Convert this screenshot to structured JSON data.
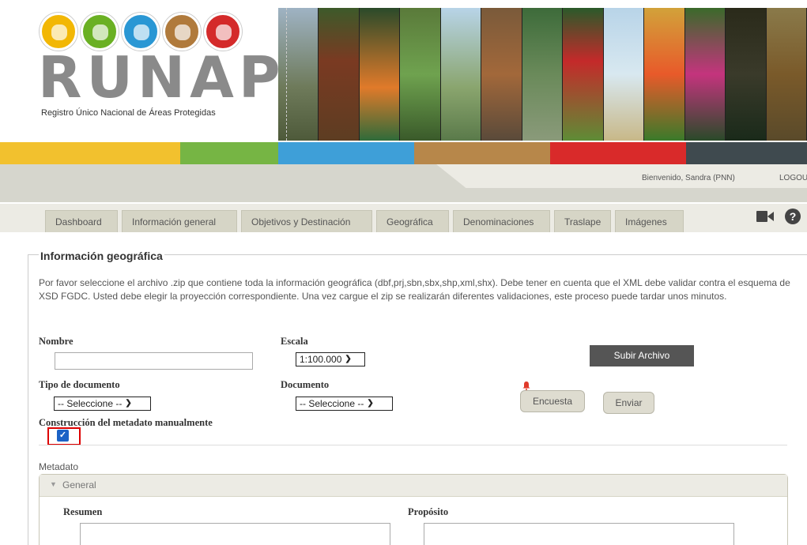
{
  "header": {
    "logo_text": "RUNAP",
    "logo_subtitle": "Registro Único Nacional de Áreas Protegidas",
    "logo_circle_colors": [
      "#f2b705",
      "#6ab023",
      "#2a97d4",
      "#b07a3c",
      "#d42a2a"
    ],
    "banner_colors": [
      "#7a8a6a",
      "#5d3d22",
      "#2f6b3a",
      "#6fa24f",
      "#8aa56e",
      "#3d6b8a",
      "#a2683a",
      "#5f8c36",
      "#d2a23a",
      "#c4347d",
      "#3a3a2a",
      "#7a5a2a"
    ]
  },
  "color_bar": [
    "#f2c12e",
    "#76b544",
    "#3e9fd8",
    "#b7874a",
    "#d92a2a",
    "#3f4a4f"
  ],
  "user_bar": {
    "welcome": "Bienvenido, Sandra (PNN)",
    "logout": "LOGOU"
  },
  "tabs": [
    "Dashboard",
    "Información general",
    "Objetivos y Destinación",
    "Geográfica",
    "Denominaciones",
    "Traslape",
    "Imágenes"
  ],
  "icons": {
    "video": "video-camera-icon",
    "help": "question-circle-icon",
    "bell": "bell-icon"
  },
  "form": {
    "legend": "Información geográfica",
    "intro": "Por favor seleccione el archivo .zip que contiene toda la información geográfica (dbf,prj,sbn,sbx,shp,xml,shx). Debe tener en cuenta que el XML debe validar contra el esquema de XSD FGDC. Usted debe elegir la proyección correspondiente. Una vez cargue el zip se realizarán diferentes validaciones, este proceso puede tardar unos minutos.",
    "nombre_label": "Nombre",
    "nombre_value": "",
    "escala_label": "Escala",
    "escala_value": "1:100.000",
    "subir_label": "Subir Archivo",
    "tipo_label": "Tipo de documento",
    "tipo_value": "-- Seleccione --",
    "documento_label": "Documento",
    "documento_value": "-- Seleccione --",
    "encuesta_label": "Encuesta",
    "enviar_label": "Enviar",
    "construccion_label": "Construcción del metadato manualmente",
    "construccion_checked": "✓",
    "metadato_label": "Metadato",
    "general_label": "General",
    "general_chevron": "▼",
    "resumen_label": "Resumen",
    "proposito_label": "Propósito"
  }
}
